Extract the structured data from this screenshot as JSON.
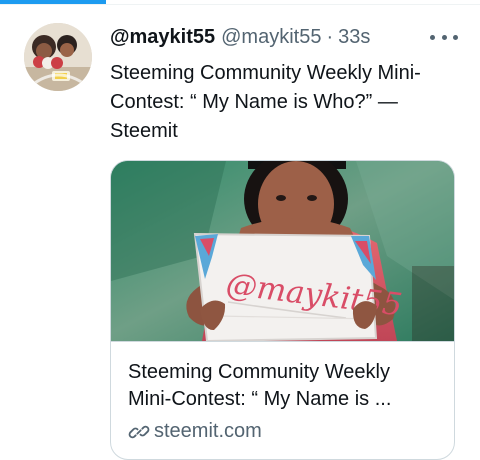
{
  "tweet": {
    "display_name": "@maykit55",
    "handle": "@maykit55",
    "separator": "·",
    "time": "33s",
    "text_line_1": "Steeming Community Weekly Mini-",
    "text_line_2": "Contest: “ My Name is Who?” —",
    "text_line_3": "Steemit"
  },
  "card": {
    "image_text": "@maykit55",
    "title_line_1": "Steeming Community Weekly",
    "title_line_2": "Mini-Contest: “ My Name is ...",
    "domain": "steemit.com"
  },
  "icons": {
    "more": "more-horizontal-icon",
    "link": "link-icon"
  },
  "colors": {
    "accent": "#1d9bf0",
    "text": "#0f1419",
    "muted": "#536471",
    "border": "#cfd9de"
  }
}
